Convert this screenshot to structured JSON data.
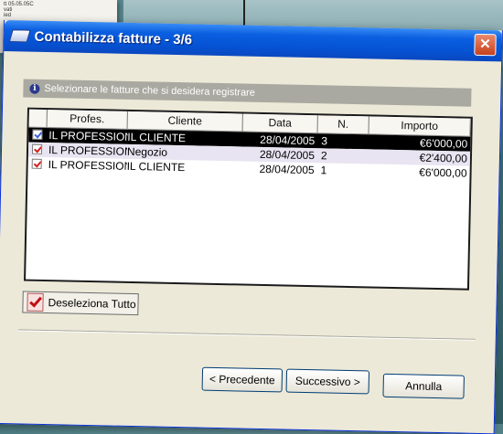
{
  "background": {
    "note_lines": [
      "tt 05.05.05C",
      "vati",
      "ied"
    ]
  },
  "window": {
    "title": "Contabilizza fatture - 3/6",
    "close_glyph": "✕"
  },
  "banner": {
    "icon": "i",
    "text": "Selezionare le fatture che si desidera registrare"
  },
  "table": {
    "columns": [
      "",
      "Profes.",
      "Cliente",
      "Data",
      "N.",
      "Importo"
    ],
    "rows": [
      {
        "checked": true,
        "profes": "IL PROFESSIONISTA",
        "cliente": "IL CLIENTE",
        "data": "28/04/2005",
        "n": "3",
        "importo": "€6'000,00",
        "selected": true
      },
      {
        "checked": true,
        "profes": "IL PROFESSIONISTA",
        "cliente": "Negozio",
        "data": "28/04/2005",
        "n": "2",
        "importo": "€2'400,00",
        "selected": false
      },
      {
        "checked": true,
        "profes": "IL PROFESSIONISTA",
        "cliente": "IL CLIENTE",
        "data": "28/04/2005",
        "n": "1",
        "importo": "€6'000,00",
        "selected": false
      }
    ]
  },
  "buttons": {
    "deselect": "Deseleziona Tutto",
    "prev": "< Precedente",
    "next": "Successivo >",
    "cancel": "Annulla"
  },
  "colors": {
    "titlebar": "#0553d4",
    "selected_row": "#000000",
    "check_mark": "#d52020"
  }
}
